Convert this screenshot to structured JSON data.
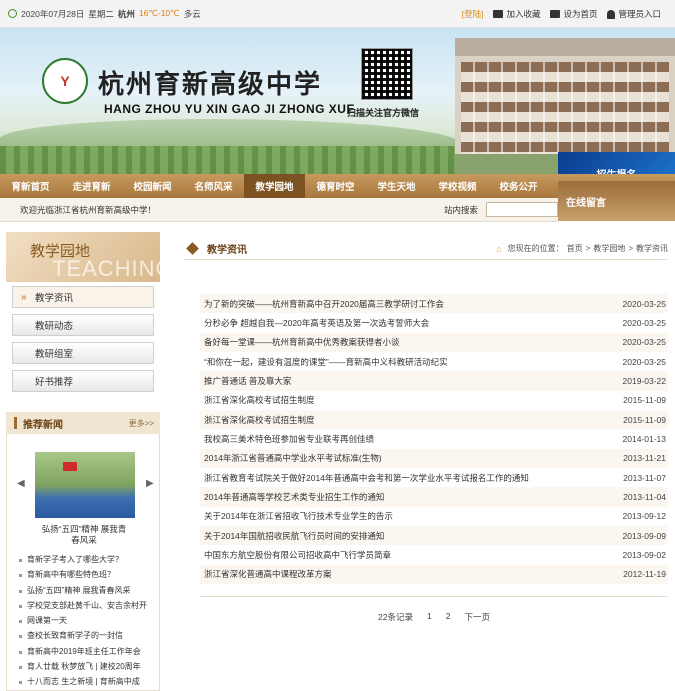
{
  "topbar": {
    "date": "2020年07月28日",
    "weekday": "星期二",
    "city": "杭州",
    "temperature": "16℃-10℃",
    "weather": "多云",
    "login": "[登陆]",
    "favorite": "加入收藏",
    "homepage": "设为首页",
    "admin": "管理员入口"
  },
  "banner": {
    "school_cn": "杭州育新高级中学",
    "school_en": "HANG ZHOU YU XIN GAO JI ZHONG XUE",
    "qr_caption": "扫描关注官方微信",
    "enroll": "招生报名",
    "online_message": "在线留言"
  },
  "nav": {
    "items": [
      "育新首页",
      "走进育新",
      "校园新闻",
      "名师风采",
      "教学园地",
      "德育时空",
      "学生天地",
      "学校视频",
      "校务公开"
    ],
    "active_index": 4
  },
  "welcome": {
    "message": "欢迎光临浙江省杭州育新高级中学！",
    "search_label": "站内搜索"
  },
  "sidebar": {
    "title_cn": "教学园地",
    "title_en": "TEACHING",
    "menu": [
      "教学资讯",
      "教研动态",
      "教研组室",
      "好书推荐"
    ],
    "active_index": 0
  },
  "recommend": {
    "title": "推荐新闻",
    "more": "更多>>",
    "caption_line1": "弘扬“五四”精神 展我青",
    "caption_line2": "春风采",
    "items": [
      "育新学子考入了哪些大学？",
      "育新高中有哪些特色班？",
      "弘扬“五四”精神 展我青春风采",
      "学校党支部赴黄千山、安吉余村开",
      "网课第一天",
      "查校长致育新学子的一封信",
      "育新高中2019年班主任工作年会",
      "育人廿载 秋梦放飞 | 建校20周年",
      "十八而志 生之新境 | 育新高中成"
    ]
  },
  "main": {
    "title": "教学资讯",
    "breadcrumb_prefix": "您现在的位置：",
    "crumb1": "首页",
    "sep1": ">",
    "crumb2": "教学园地",
    "sep2": ">",
    "crumb3": "教学资讯",
    "news": [
      {
        "title": "为了新的突破——杭州育新高中召开2020届高三教学研讨工作会",
        "date": "2020-03-25"
      },
      {
        "title": "分秒必争 超越自我—2020年高考英语及第一次选考誓师大会",
        "date": "2020-03-25"
      },
      {
        "title": "备好每一堂课——杭州育新高中优秀教案获得者小谈",
        "date": "2020-03-25"
      },
      {
        "title": "“和你在一起，建设有温度的课堂”——育新高中义科教研活动纪实",
        "date": "2020-03-25"
      },
      {
        "title": "推广普通话 普及靠大家",
        "date": "2019-03-22"
      },
      {
        "title": "浙江省深化高校考试招生制度",
        "date": "2015-11-09"
      },
      {
        "title": "浙江省深化高校考试招生制度",
        "date": "2015-11-09"
      },
      {
        "title": "我校高三美术特色班参加省专业联考再创佳绩",
        "date": "2014-01-13"
      },
      {
        "title": "2014年浙江省普通高中学业水平考试标准(生物)",
        "date": "2013-11-21"
      },
      {
        "title": "浙江省教育考试院关于做好2014年普通高中会考和第一次学业水平考试报名工作的通知",
        "date": "2013-11-07"
      },
      {
        "title": "2014年普通高等学校艺术类专业招生工作的通知",
        "date": "2013-11-04"
      },
      {
        "title": "关于2014年在浙江省招收飞行技术专业学生的告示",
        "date": "2013-09-12"
      },
      {
        "title": "关于2014年国航招收民航飞行员时间的安排通知",
        "date": "2013-09-09"
      },
      {
        "title": "中国东方航空股份有限公司招收高中飞行学员简章",
        "date": "2013-09-02"
      },
      {
        "title": "浙江省深化普通高中课程改革方案",
        "date": "2012-11-19"
      }
    ],
    "pager": {
      "total": "22条记录",
      "page1": "1",
      "page2": "2",
      "next": "下一页"
    }
  },
  "colors": {
    "nav_bg": "#a8763b",
    "nav_active": "#7c5222",
    "accent_orange": "#e07a10",
    "heading_brown": "#6b4316"
  }
}
